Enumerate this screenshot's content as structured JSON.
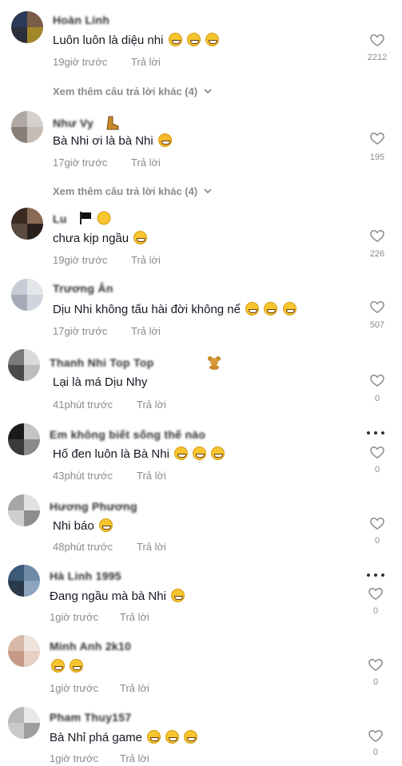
{
  "common": {
    "reply_label": "Trả lời",
    "view_more_label": "Xem thêm câu trả lời khác (4)"
  },
  "comments": [
    {
      "username": "Hoàn Linh",
      "text": "Luôn luôn là diệu nhi",
      "emoji_count": 3,
      "time": "19giờ trước",
      "likes": "2212",
      "avatar_colors": [
        "#2c3a5a",
        "#7a5c48",
        "#2b2f3b",
        "#a2862a"
      ]
    },
    {
      "username": "Như Vy",
      "text": "Bà Nhi ơi là bà Nhi",
      "emoji_count": 1,
      "time": "17giờ trước",
      "likes": "195",
      "avatar_colors": [
        "#b0a8a4",
        "#d6d0cc",
        "#8a7f78",
        "#c6bcb5"
      ]
    },
    {
      "username": "Lu",
      "text": "chưa kịp ngầu",
      "emoji_count": 1,
      "time": "19giờ trước",
      "likes": "226",
      "avatar_colors": [
        "#3a2a22",
        "#8a6a56",
        "#5a4a40",
        "#2a201c"
      ]
    },
    {
      "username": "Trương Ân",
      "text": "Dịu Nhi không tấu hài đời không nể",
      "emoji_count": 3,
      "time": "17giờ trước",
      "likes": "507",
      "avatar_colors": [
        "#c8ccd6",
        "#e4e6ea",
        "#a7abb8",
        "#d0d4dc"
      ]
    },
    {
      "username": "Thanh Nhi Top Top",
      "text": "Lại là má Dịu Nhy",
      "emoji_count": 0,
      "time": "41phút trước",
      "likes": "0",
      "avatar_colors": [
        "#7a7a7a",
        "#dadada",
        "#4a4a4a",
        "#bdbdbd"
      ]
    },
    {
      "username": "Em không biết sống thế nào",
      "text": "Hố đen luôn là Bà Nhi",
      "emoji_count": 3,
      "time": "43phút trước",
      "likes": "0",
      "avatar_colors": [
        "#1a1a1a",
        "#c4c4c4",
        "#3a3a3a",
        "#8a8a8a"
      ]
    },
    {
      "username": "Hương Phương",
      "text": "Nhi báo",
      "emoji_count": 1,
      "time": "48phút trước",
      "likes": "0",
      "avatar_colors": [
        "#a6a6a6",
        "#e2e2e2",
        "#cfcfcf",
        "#8e8e8e"
      ]
    },
    {
      "username": "Hà Linh 1995",
      "text": "Đang ngầu mà bà Nhi",
      "emoji_count": 1,
      "time": "1giờ trước",
      "likes": "0",
      "avatar_colors": [
        "#3a5a78",
        "#6e8aa6",
        "#2a3a4a",
        "#8da5bd"
      ]
    },
    {
      "username": "Minh Anh 2k10",
      "text": "",
      "emoji_count": 2,
      "time": "1giờ trước",
      "likes": "0",
      "avatar_colors": [
        "#d8b8a8",
        "#efe4dc",
        "#c49a86",
        "#e6cfc3"
      ]
    },
    {
      "username": "Pham Thuy157",
      "text": "Bà Nhỉ phá game",
      "emoji_count": 3,
      "time": "1giờ trước",
      "likes": "0",
      "avatar_colors": [
        "#b8b8b8",
        "#e8e8e8",
        "#c9c9c9",
        "#9e9e9e"
      ]
    }
  ]
}
